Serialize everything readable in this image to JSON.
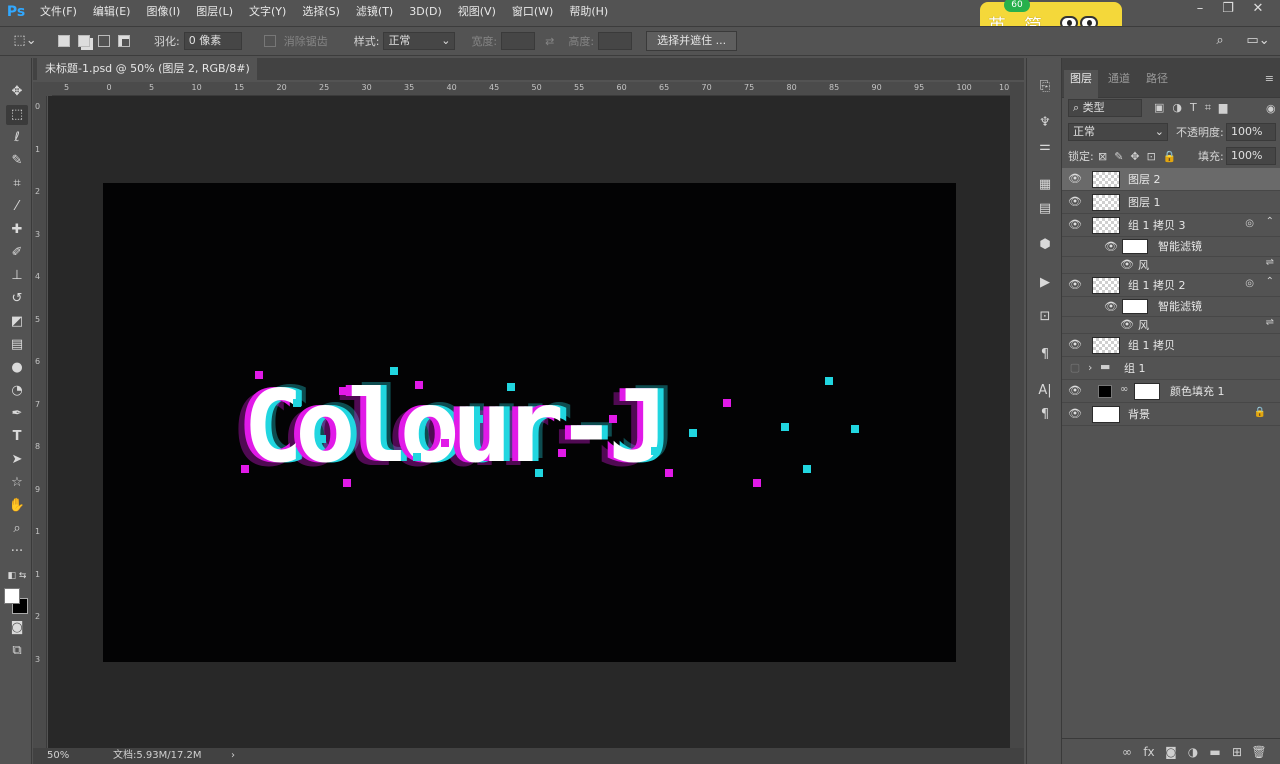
{
  "app": {
    "logo": "Ps"
  },
  "menu": [
    "文件(F)",
    "编辑(E)",
    "图像(I)",
    "图层(L)",
    "文字(Y)",
    "选择(S)",
    "滤镜(T)",
    "3D(D)",
    "视图(V)",
    "窗口(W)",
    "帮助(H)"
  ],
  "ime": {
    "badge": "60",
    "char1": "英",
    "char2": "简"
  },
  "options": {
    "feather_label": "羽化:",
    "feather_value": "0 像素",
    "antialias_label": "消除锯齿",
    "style_label": "样式:",
    "style_value": "正常",
    "width_label": "宽度:",
    "height_label": "高度:",
    "select_mask_button": "选择并遮住 ..."
  },
  "document": {
    "tab_title": "未标题-1.psd @ 50% (图层 2, RGB/8#) *",
    "zoom": "50%",
    "doc_size": "文档:5.93M/17.2M",
    "canvas_text": "Colour-J"
  },
  "rulers": {
    "h": [
      "5",
      "0",
      "5",
      "10",
      "15",
      "20",
      "25",
      "30",
      "35",
      "40",
      "45",
      "50",
      "55",
      "60",
      "65",
      "70",
      "75",
      "80",
      "85",
      "90",
      "95",
      "100",
      "10"
    ],
    "v": [
      "0",
      "1",
      "2",
      "3",
      "4",
      "5",
      "6",
      "7",
      "8",
      "9",
      "1",
      "1",
      "2",
      "3"
    ]
  },
  "layers_panel": {
    "tabs": [
      "图层",
      "通道",
      "路径"
    ],
    "filter_kind": "类型",
    "blend_mode": "正常",
    "opacity_label": "不透明度:",
    "opacity_value": "100%",
    "lock_label": "锁定:",
    "fill_label": "填充:",
    "fill_value": "100%",
    "layers": [
      {
        "name": "图层 2",
        "selected": true
      },
      {
        "name": "图层 1"
      },
      {
        "name": "组 1 拷贝 3",
        "smart": true
      },
      {
        "name": "智能滤镜",
        "sub": true
      },
      {
        "name": "风",
        "filter": true
      },
      {
        "name": "组 1 拷贝 2",
        "smart": true
      },
      {
        "name": "智能滤镜",
        "sub": true
      },
      {
        "name": "风",
        "filter": true
      },
      {
        "name": "组 1 拷贝"
      },
      {
        "name": "组 1",
        "group": true
      },
      {
        "name": "颜色填充 1",
        "fill": true
      },
      {
        "name": "背景",
        "locked": true
      }
    ]
  },
  "colors": {
    "magenta": "#e11ae8",
    "cyan": "#21d6e0",
    "canvas": "#030304"
  }
}
